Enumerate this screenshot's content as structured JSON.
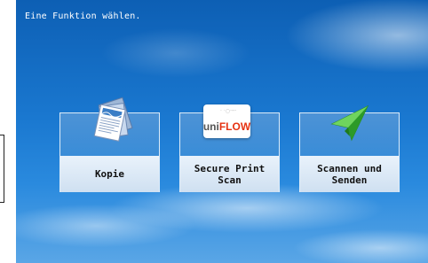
{
  "header": {
    "instruction": "Eine Funktion wählen."
  },
  "tiles": [
    {
      "label": "Kopie",
      "icon": "copy-documents-icon"
    },
    {
      "label": "Secure Print\nScan",
      "icon": "uniflow-logo",
      "logo_text_left": "uni",
      "logo_text_right": "FLOW"
    },
    {
      "label": "Scannen und\nSenden",
      "icon": "paper-plane-send-icon"
    }
  ],
  "colors": {
    "sky": "#1a78d0",
    "tile_label_bg": "#e9f2fb",
    "uniflow_red": "#e63312",
    "plane_green": "#3db634"
  }
}
